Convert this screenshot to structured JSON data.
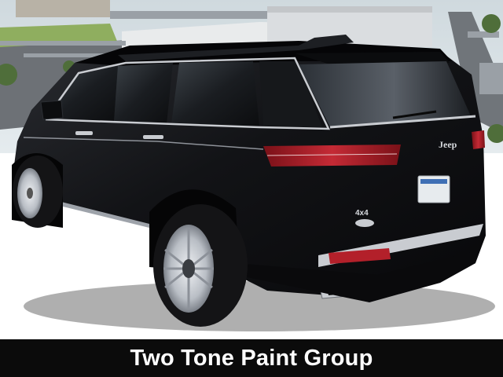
{
  "caption": {
    "text": "Two Tone Paint Group"
  },
  "vehicle": {
    "badge_brand": "Jeep",
    "badge_drivetrain": "4x4"
  },
  "colors": {
    "body_paint": "#111114",
    "roof_paint": "#050507",
    "sky": "#dfe4e8",
    "caption_bar": "#0b0b0b",
    "caption_text": "#ffffff",
    "taillight": "#b3202a",
    "chrome": "#c9ccd1"
  }
}
